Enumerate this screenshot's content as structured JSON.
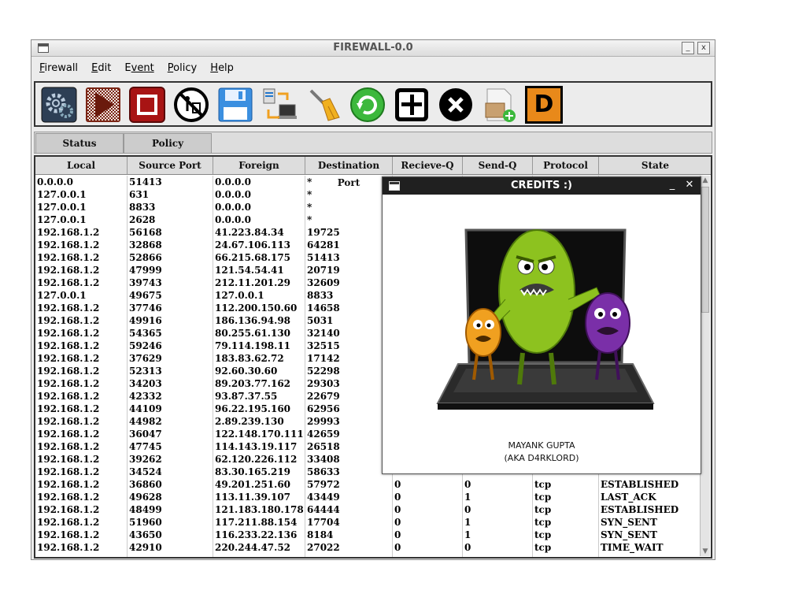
{
  "window": {
    "title": "FIREWALL-0.0",
    "minimize": "_",
    "close": "x"
  },
  "menu": [
    {
      "first": "F",
      "rest": "irewall"
    },
    {
      "first": "E",
      "rest": "dit"
    },
    {
      "first": "E",
      "rest": "vent"
    },
    {
      "first": "P",
      "rest": "olicy"
    },
    {
      "first": "H",
      "rest": "elp"
    }
  ],
  "toolbar": {
    "icons": [
      "settings-gear-icon",
      "play-icon",
      "stop-icon",
      "clear-log-icon",
      "save-floppy-icon",
      "network-transfer-icon",
      "sweep-broom-icon",
      "refresh-icon",
      "add-rule-icon",
      "remove-rule-icon",
      "new-package-icon",
      "d-icon"
    ],
    "d_label": "D"
  },
  "tabs": [
    "Status",
    "Policy"
  ],
  "columns": [
    "Local",
    "Source Port",
    "Foreign",
    "Destination Port",
    "Recieve-Q",
    "Send-Q",
    "Protocol",
    "State"
  ],
  "rows": [
    [
      "0.0.0.0",
      "51413",
      "0.0.0.0",
      "*",
      "",
      "",
      "",
      ""
    ],
    [
      "127.0.0.1",
      "631",
      "0.0.0.0",
      "*",
      "",
      "",
      "",
      ""
    ],
    [
      "127.0.0.1",
      "8833",
      "0.0.0.0",
      "*",
      "",
      "",
      "",
      ""
    ],
    [
      "127.0.0.1",
      "2628",
      "0.0.0.0",
      "*",
      "",
      "",
      "",
      ""
    ],
    [
      "192.168.1.2",
      "56168",
      "41.223.84.34",
      "19725",
      "",
      "",
      "",
      ""
    ],
    [
      "192.168.1.2",
      "32868",
      "24.67.106.113",
      "64281",
      "",
      "",
      "",
      ""
    ],
    [
      "192.168.1.2",
      "52866",
      "66.215.68.175",
      "51413",
      "",
      "",
      "",
      ""
    ],
    [
      "192.168.1.2",
      "47999",
      "121.54.54.41",
      "20719",
      "",
      "",
      "",
      ""
    ],
    [
      "192.168.1.2",
      "39743",
      "212.11.201.29",
      "32609",
      "",
      "",
      "",
      ""
    ],
    [
      "127.0.0.1",
      "49675",
      "127.0.0.1",
      "8833",
      "",
      "",
      "",
      ""
    ],
    [
      "192.168.1.2",
      "37746",
      "112.200.150.60",
      "14658",
      "",
      "",
      "",
      ""
    ],
    [
      "192.168.1.2",
      "49916",
      "186.136.94.98",
      "5031",
      "",
      "",
      "",
      ""
    ],
    [
      "192.168.1.2",
      "54365",
      "80.255.61.130",
      "32140",
      "",
      "",
      "",
      ""
    ],
    [
      "192.168.1.2",
      "59246",
      "79.114.198.11",
      "32515",
      "",
      "",
      "",
      ""
    ],
    [
      "192.168.1.2",
      "37629",
      "183.83.62.72",
      "17142",
      "",
      "",
      "",
      ""
    ],
    [
      "192.168.1.2",
      "52313",
      "92.60.30.60",
      "52298",
      "",
      "",
      "",
      ""
    ],
    [
      "192.168.1.2",
      "34203",
      "89.203.77.162",
      "29303",
      "",
      "",
      "",
      ""
    ],
    [
      "192.168.1.2",
      "42332",
      "93.87.37.55",
      "22679",
      "",
      "",
      "",
      ""
    ],
    [
      "192.168.1.2",
      "44109",
      "96.22.195.160",
      "62956",
      "",
      "",
      "",
      ""
    ],
    [
      "192.168.1.2",
      "44982",
      "2.89.239.130",
      "29993",
      "",
      "",
      "",
      ""
    ],
    [
      "192.168.1.2",
      "36047",
      "122.148.170.111",
      "42659",
      "",
      "",
      "",
      ""
    ],
    [
      "192.168.1.2",
      "47745",
      "114.143.19.117",
      "26518",
      "",
      "",
      "",
      ""
    ],
    [
      "192.168.1.2",
      "39262",
      "62.120.226.112",
      "33408",
      "",
      "",
      "",
      ""
    ],
    [
      "192.168.1.2",
      "34524",
      "83.30.165.219",
      "58633",
      "",
      "",
      "",
      ""
    ],
    [
      "192.168.1.2",
      "36860",
      "49.201.251.60",
      "57972",
      "0",
      "0",
      "tcp",
      "ESTABLISHED"
    ],
    [
      "192.168.1.2",
      "49628",
      "113.11.39.107",
      "43449",
      "0",
      "1",
      "tcp",
      "LAST_ACK"
    ],
    [
      "192.168.1.2",
      "48499",
      "121.183.180.178",
      "64444",
      "0",
      "0",
      "tcp",
      "ESTABLISHED"
    ],
    [
      "192.168.1.2",
      "51960",
      "117.211.88.154",
      "17704",
      "0",
      "1",
      "tcp",
      "SYN_SENT"
    ],
    [
      "192.168.1.2",
      "43650",
      "116.233.22.136",
      "8184",
      "0",
      "1",
      "tcp",
      "SYN_SENT"
    ],
    [
      "192.168.1.2",
      "42910",
      "220.244.47.52",
      "27022",
      "0",
      "0",
      "tcp",
      "TIME_WAIT"
    ]
  ],
  "dialog": {
    "title": "CREDITS :)",
    "minimize": "_",
    "close": "✕",
    "author": "MAYANK GUPTA",
    "alias": "(AKA D4RKLORD)"
  },
  "colors": {
    "dialog_titlebar": "#202020",
    "virus_green": "#8dc21f",
    "virus_purple": "#7a2fa8",
    "virus_orange": "#f0a020",
    "d_button": "#e8891a"
  }
}
